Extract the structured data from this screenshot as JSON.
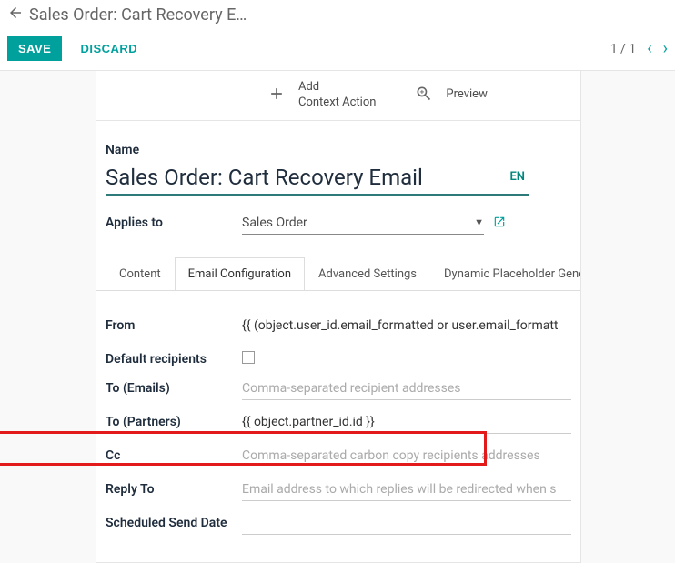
{
  "breadcrumb": {
    "title": "Sales Order: Cart Recovery E…"
  },
  "actions": {
    "save": "SAVE",
    "discard": "DISCARD"
  },
  "pager": {
    "text": "1 / 1"
  },
  "statButtons": {
    "addContext": {
      "line1": "Add",
      "line2": "Context Action"
    },
    "preview": "Preview"
  },
  "form": {
    "nameLabel": "Name",
    "nameValue": "Sales Order: Cart Recovery Email",
    "lang": "EN",
    "appliesLabel": "Applies to",
    "appliesValue": "Sales Order"
  },
  "tabs": {
    "content": "Content",
    "email": "Email Configuration",
    "advanced": "Advanced Settings",
    "dynamic": "Dynamic Placeholder Generator"
  },
  "fields": {
    "fromLabel": "From",
    "fromValue": "{{ (object.user_id.email_formatted or user.email_formatt",
    "defaultRecipLabel": "Default recipients",
    "toEmailsLabel": "To (Emails)",
    "toEmailsPlaceholder": "Comma-separated recipient addresses",
    "toPartnersLabel": "To (Partners)",
    "toPartnersValue": "{{ object.partner_id.id }}",
    "ccLabel": "Cc",
    "ccPlaceholder": "Comma-separated carbon copy recipients addresses",
    "replyToLabel": "Reply To",
    "replyToPlaceholder": "Email address to which replies will be redirected when s",
    "schedLabel": "Scheduled Send Date"
  }
}
